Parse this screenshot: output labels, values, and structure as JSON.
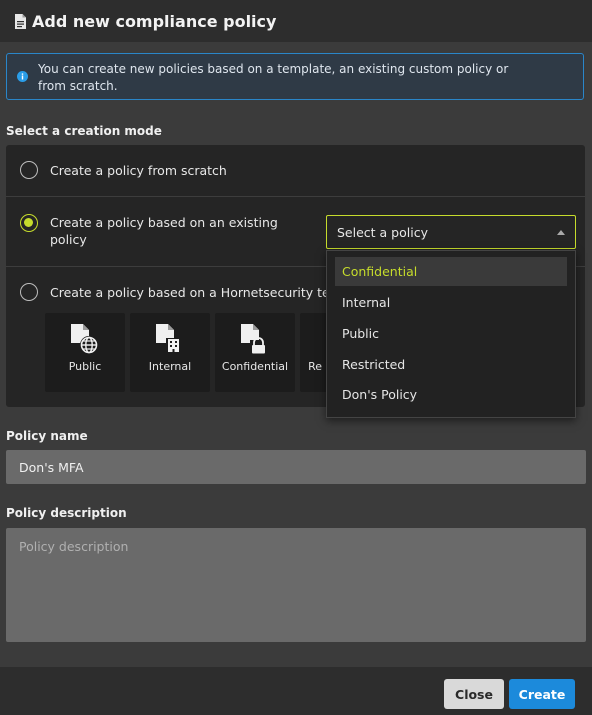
{
  "dialog": {
    "title": "Add new compliance policy",
    "info_text": "You can create new policies based on a template, an existing custom policy or from scratch."
  },
  "creation_mode": {
    "label": "Select a creation mode",
    "options": [
      {
        "label": "Create a policy from scratch",
        "checked": false
      },
      {
        "label": "Create a policy based on an existing policy",
        "checked": true
      },
      {
        "label": "Create a policy based on a Hornetsecurity temp",
        "checked": false
      }
    ],
    "select": {
      "placeholder": "Select a policy",
      "options": [
        "Confidential",
        "Internal",
        "Public",
        "Restricted",
        "Don's Policy"
      ],
      "highlighted": "Confidential"
    },
    "templates": [
      {
        "label": "Public",
        "icon": "document-globe-icon"
      },
      {
        "label": "Internal",
        "icon": "document-building-icon"
      },
      {
        "label": "Confidential",
        "icon": "document-lock-icon"
      },
      {
        "label": "Re",
        "icon": "document-icon"
      }
    ]
  },
  "policy_name": {
    "label": "Policy name",
    "value": "Don's MFA"
  },
  "policy_description": {
    "label": "Policy description",
    "placeholder": "Policy description"
  },
  "footer": {
    "close_label": "Close",
    "create_label": "Create"
  },
  "colors": {
    "accent": "#c6dc2c",
    "primary": "#1c8adb",
    "info_border": "#2a86c9"
  }
}
